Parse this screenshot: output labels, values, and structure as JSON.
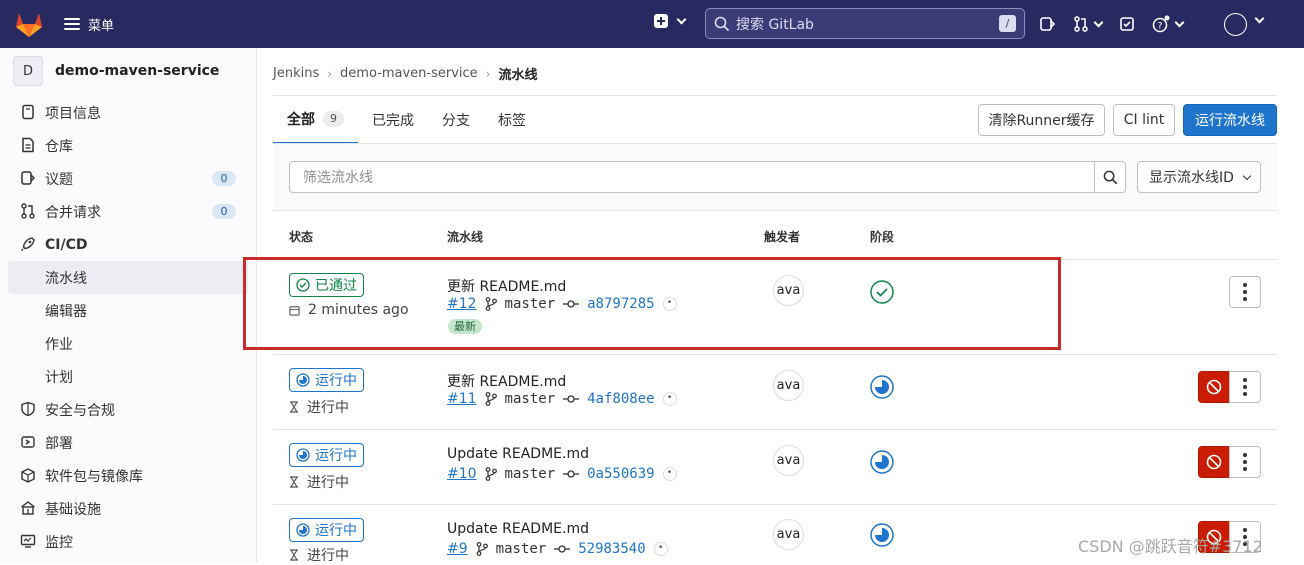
{
  "topbar": {
    "menu_label": "菜单",
    "search_placeholder": "搜索 GitLab",
    "search_shortcut": "/"
  },
  "sidebar": {
    "project_initial": "D",
    "project_name": "demo-maven-service",
    "items": [
      {
        "label": "项目信息",
        "icon": "info-icon"
      },
      {
        "label": "仓库",
        "icon": "repository-icon"
      },
      {
        "label": "议题",
        "icon": "issues-icon",
        "count": "0"
      },
      {
        "label": "合并请求",
        "icon": "merge-request-icon",
        "count": "0"
      },
      {
        "label": "CI/CD",
        "icon": "rocket-icon"
      },
      {
        "label": "流水线"
      },
      {
        "label": "编辑器"
      },
      {
        "label": "作业"
      },
      {
        "label": "计划"
      },
      {
        "label": "安全与合规",
        "icon": "shield-icon"
      },
      {
        "label": "部署",
        "icon": "deploy-icon"
      },
      {
        "label": "软件包与镜像库",
        "icon": "package-icon"
      },
      {
        "label": "基础设施",
        "icon": "infrastructure-icon"
      },
      {
        "label": "监控",
        "icon": "monitor-icon"
      }
    ]
  },
  "breadcrumb": [
    "Jenkins",
    "demo-maven-service",
    "流水线"
  ],
  "tabs": [
    {
      "label": "全部",
      "count": "9"
    },
    {
      "label": "已完成"
    },
    {
      "label": "分支"
    },
    {
      "label": "标签"
    }
  ],
  "actions": {
    "clear_cache": "清除Runner缓存",
    "ci_lint": "CI lint",
    "run_pipeline": "运行流水线"
  },
  "filter": {
    "placeholder": "筛选流水线",
    "id_select": "显示流水线ID"
  },
  "table": {
    "headers": {
      "status": "状态",
      "pipeline": "流水线",
      "triggerer": "触发者",
      "stage": "阶段"
    },
    "rows": [
      {
        "status": "已通过",
        "status_type": "passed",
        "sub": "2 minutes ago",
        "title": "更新 README.md",
        "id": "#12",
        "branch": "master",
        "sha": "a8797285",
        "latest": "最新",
        "user": "ava",
        "stage": "success"
      },
      {
        "status": "运行中",
        "status_type": "running",
        "sub": "进行中",
        "title": "更新 README.md",
        "id": "#11",
        "branch": "master",
        "sha": "4af808ee",
        "user": "ava",
        "stage": "running"
      },
      {
        "status": "运行中",
        "status_type": "running",
        "sub": "进行中",
        "title": "Update README.md",
        "id": "#10",
        "branch": "master",
        "sha": "0a550639",
        "user": "ava",
        "stage": "running"
      },
      {
        "status": "运行中",
        "status_type": "running",
        "sub": "进行中",
        "title": "Update README.md",
        "id": "#9",
        "branch": "master",
        "sha": "52983540",
        "user": "ava",
        "stage": "running"
      }
    ]
  },
  "colors": {
    "topbar": "#292961",
    "primary": "#1f75cb",
    "success": "#108548",
    "danger": "#c91c00",
    "highlight": "#c92a2a"
  },
  "watermark": "CSDN @跳跃音符#3712"
}
